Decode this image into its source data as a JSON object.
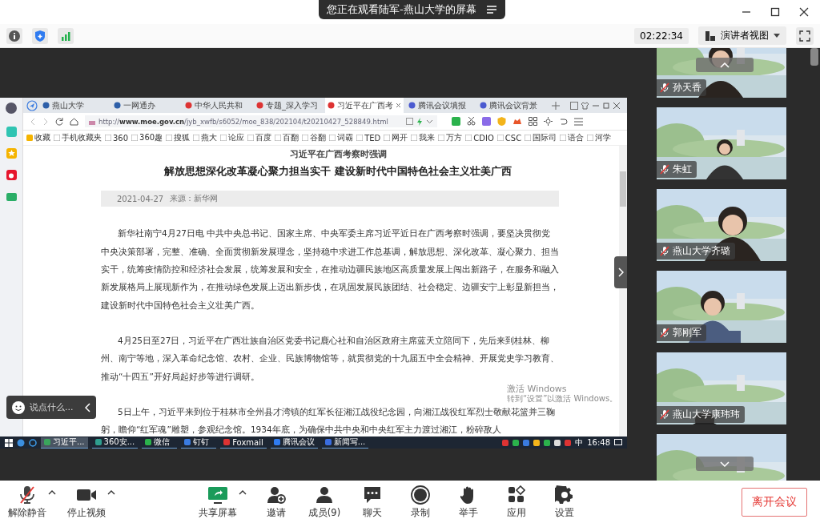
{
  "banner": {
    "text": "您正在观看陆军-燕山大学的屏幕"
  },
  "toolbar": {
    "timer": "02:22:34",
    "view_button": "演讲者视图"
  },
  "shared_screen": {
    "tabs": [
      {
        "label": "燕山大学",
        "selected": false
      },
      {
        "label": "一网通办",
        "selected": false
      },
      {
        "label": "中华人民共和",
        "selected": false
      },
      {
        "label": "专题_深入学习",
        "selected": false
      },
      {
        "label": "习近平在广西考",
        "selected": true
      },
      {
        "label": "腾讯会议填报",
        "selected": false
      },
      {
        "label": "腾讯会议背景",
        "selected": false
      }
    ],
    "url": {
      "prefix": "http://",
      "host": "www.moe.gov.cn",
      "path": "/jyb_xwfb/s6052/moe_838/202104/t20210427_528849.html"
    },
    "bookmarks": [
      "收藏",
      "手机收藏夹",
      "360",
      "360趣",
      "搜狐",
      "燕大",
      "论应",
      "百度",
      "百翻",
      "谷翻",
      "词霸",
      "TED",
      "网开",
      "我来",
      "万方",
      "CDIO",
      "CSC",
      "国际司",
      "语合",
      "河学"
    ],
    "article": {
      "kicker": "习近平在广西考察时强调",
      "title": "解放思想深化改革凝心聚力担当实干 建设新时代中国特色社会主义壮美广西",
      "date": "2021-04-27",
      "source": "来源：新华网",
      "paragraphs": [
        "新华社南宁4月27日电 中共中央总书记、国家主席、中央军委主席习近平近日在广西考察时强调，要坚决贯彻党中央决策部署，完整、准确、全面贯彻新发展理念，坚持稳中求进工作总基调，解放思想、深化改革、凝心聚力、担当实干，统筹疫情防控和经济社会发展，统筹发展和安全，在推动边疆民族地区高质量发展上闯出新路子，在服务和融入新发展格局上展现新作为，在推动绿色发展上迈出新步伐，在巩固发展民族团结、社会稳定、边疆安宁上彰显新担当，建设新时代中国特色社会主义壮美广西。",
        "4月25日至27日，习近平在广西壮族自治区党委书记鹿心社和自治区政府主席蓝天立陪同下，先后来到桂林、柳州、南宁等地，深入革命纪念馆、农村、企业、民族博物馆等，就贯彻党的十九届五中全会精神、开展党史学习教育、推动“十四五”开好局起好步等进行调研。",
        "5日上午，习近平来到位于桂林市全州县才湾镇的红军长征湘江战役纪念园，向湘江战役红军烈士敬献花篮并三鞠躬，瞻仰“红军魂”雕塑，参观纪念馆。1934年底，为确保中共中央和中央红军主力渡过湘江，粉碎敌人"
      ]
    },
    "taskbar": {
      "items": [
        {
          "label": "习近平...",
          "selected": true
        },
        {
          "label": "360安...",
          "selected": false
        },
        {
          "label": "微信",
          "selected": false
        },
        {
          "label": "钉钉",
          "selected": false
        },
        {
          "label": "Foxmail",
          "selected": false
        },
        {
          "label": "腾讯会议",
          "selected": false
        },
        {
          "label": "新闻写...",
          "selected": false
        }
      ],
      "ime": "中",
      "clock": "16:48"
    },
    "activation": {
      "title": "激活 Windows",
      "hint": "转到“设置”以激活 Windows。"
    }
  },
  "chat": {
    "placeholder": "说点什么..."
  },
  "participants": [
    {
      "name": "孙天香",
      "muted": true
    },
    {
      "name": "朱虹",
      "muted": true
    },
    {
      "name": "燕山大学齐璐",
      "muted": true
    },
    {
      "name": "郭刚军",
      "muted": true
    },
    {
      "name": "燕山大学康玮玮",
      "muted": true
    },
    {
      "kind": "picture"
    }
  ],
  "controls": [
    {
      "label": "解除静音",
      "kind": "mic",
      "caret": true
    },
    {
      "label": "停止视频",
      "kind": "video",
      "caret": true
    },
    {
      "label": "共享屏幕",
      "kind": "share",
      "caret": true
    },
    {
      "label": "邀请",
      "kind": "invite",
      "caret": false
    },
    {
      "label": "成员(9)",
      "kind": "members",
      "caret": false
    },
    {
      "label": "聊天",
      "kind": "chat",
      "caret": false
    },
    {
      "label": "录制",
      "kind": "record",
      "caret": false
    },
    {
      "label": "举手",
      "kind": "hand",
      "caret": false
    },
    {
      "label": "应用",
      "kind": "apps",
      "caret": false
    },
    {
      "label": "设置",
      "kind": "settings",
      "caret": false
    }
  ],
  "leave_button": "离开会议"
}
